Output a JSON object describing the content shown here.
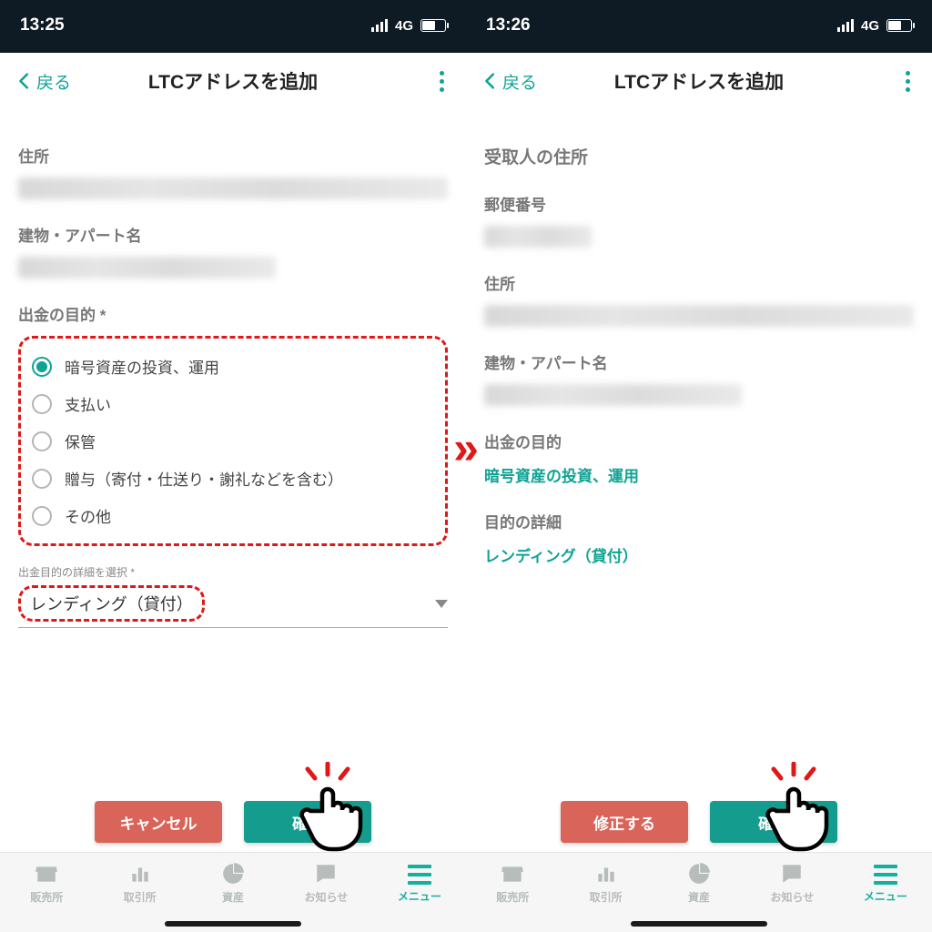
{
  "colors": {
    "accent": "#0fa395",
    "danger": "#d8645a",
    "highlight": "#e01818"
  },
  "left": {
    "statusTime": "13:25",
    "network": "4G",
    "backLabel": "戻る",
    "pageTitle": "LTCアドレスを追加",
    "labels": {
      "address": "住所",
      "building": "建物・アパート名",
      "purpose": "出金の目的 *",
      "detailTiny": "出金目的の詳細を選択 *"
    },
    "radios": [
      {
        "label": "暗号資産の投資、運用",
        "selected": true
      },
      {
        "label": "支払い",
        "selected": false
      },
      {
        "label": "保管",
        "selected": false
      },
      {
        "label": "贈与（寄付・仕送り・謝礼などを含む）",
        "selected": false
      },
      {
        "label": "その他",
        "selected": false
      }
    ],
    "dropdownValue": "レンディング（貸付）",
    "buttons": {
      "cancel": "キャンセル",
      "confirm": "確認"
    }
  },
  "right": {
    "statusTime": "13:26",
    "network": "4G",
    "backLabel": "戻る",
    "pageTitle": "LTCアドレスを追加",
    "labels": {
      "recipientAddress": "受取人の住所",
      "postal": "郵便番号",
      "address": "住所",
      "building": "建物・アパート名",
      "purpose": "出金の目的",
      "detail": "目的の詳細"
    },
    "values": {
      "purpose": "暗号資産の投資、運用",
      "detail": "レンディング（貸付）"
    },
    "buttons": {
      "edit": "修正する",
      "submit": "確定"
    }
  },
  "tabs": {
    "shop": "販売所",
    "exchange": "取引所",
    "assets": "資産",
    "notice": "お知らせ",
    "menu": "メニュー"
  }
}
